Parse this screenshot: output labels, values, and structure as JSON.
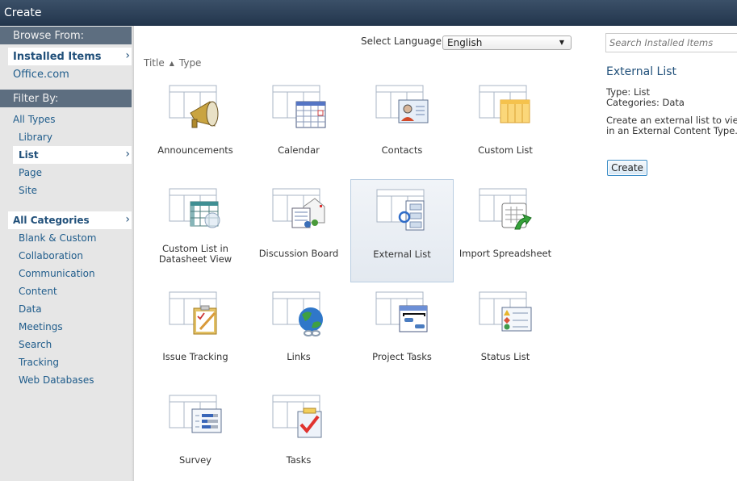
{
  "window": {
    "title": "Create"
  },
  "sidebar": {
    "browse_heading": "Browse From:",
    "browse_items": [
      {
        "label": "Installed Items",
        "selected": true
      },
      {
        "label": "Office.com",
        "selected": false
      }
    ],
    "filter_heading": "Filter By:",
    "types": [
      {
        "label": "All Types"
      },
      {
        "label": "Library"
      },
      {
        "label": "List",
        "selected": true
      },
      {
        "label": "Page"
      },
      {
        "label": "Site"
      }
    ],
    "categories": [
      {
        "label": "All Categories",
        "selected": true
      },
      {
        "label": "Blank & Custom"
      },
      {
        "label": "Collaboration"
      },
      {
        "label": "Communication"
      },
      {
        "label": "Content"
      },
      {
        "label": "Data"
      },
      {
        "label": "Meetings"
      },
      {
        "label": "Search"
      },
      {
        "label": "Tracking"
      },
      {
        "label": "Web Databases"
      }
    ],
    "chevron_icon": "›"
  },
  "main": {
    "language_label": "Select Language:",
    "language_value": "English",
    "sort": {
      "title": "Title",
      "type": "Type",
      "sort_indicator": "▲"
    },
    "items": [
      {
        "label": "Announcements",
        "icon": "megaphone-icon"
      },
      {
        "label": "Calendar",
        "icon": "calendar-icon"
      },
      {
        "label": "Contacts",
        "icon": "contact-card-icon"
      },
      {
        "label": "Custom List",
        "icon": "custom-list-icon"
      },
      {
        "label": "Custom List in Datasheet View",
        "icon": "datasheet-icon"
      },
      {
        "label": "Discussion Board",
        "icon": "discussion-icon"
      },
      {
        "label": "External List",
        "icon": "external-list-icon",
        "selected": true
      },
      {
        "label": "Import Spreadsheet",
        "icon": "import-spreadsheet-icon"
      },
      {
        "label": "Issue Tracking",
        "icon": "clipboard-icon"
      },
      {
        "label": "Links",
        "icon": "globe-link-icon"
      },
      {
        "label": "Project Tasks",
        "icon": "gantt-icon"
      },
      {
        "label": "Status List",
        "icon": "status-icon"
      },
      {
        "label": "Survey",
        "icon": "survey-icon"
      },
      {
        "label": "Tasks",
        "icon": "task-check-icon"
      }
    ]
  },
  "details": {
    "search_placeholder": "Search Installed Items",
    "title": "External List",
    "type_line": "Type: List",
    "categories_line": "Categories: Data",
    "description_line1": "Create an external list to view",
    "description_line2": "in an External Content Type.",
    "create_label": "Create"
  }
}
